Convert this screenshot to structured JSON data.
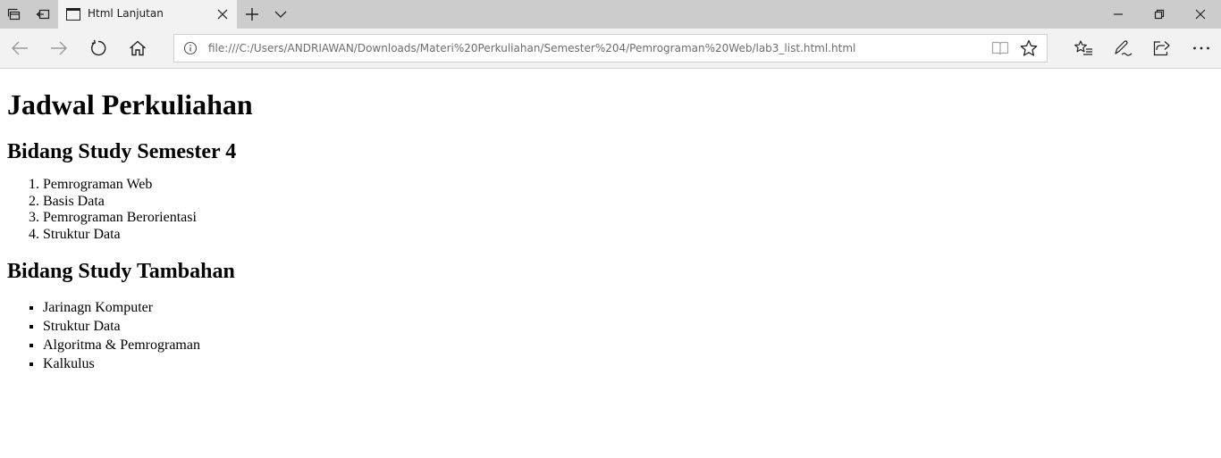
{
  "browser": {
    "tab": {
      "title": "Html Lanjutan"
    },
    "address": {
      "url": "file:///C:/Users/ANDRIAWAN/Downloads/Materi%20Perkuliahan/Semester%204/Pemrograman%20Web/lab3_list.html.html"
    },
    "icons": [
      "tab-manager-icon",
      "set-aside-tabs-icon",
      "page-icon",
      "close-icon",
      "plus-icon",
      "chevron-down-icon",
      "minimize-icon",
      "restore-icon",
      "window-close-icon",
      "back-arrow-icon",
      "forward-arrow-icon",
      "refresh-icon",
      "home-icon",
      "info-icon",
      "reading-view-icon",
      "star-icon",
      "favorites-icon",
      "pen-icon",
      "share-icon",
      "more-icon"
    ]
  },
  "page": {
    "title": "Jadwal Perkuliahan",
    "section1": {
      "heading": "Bidang Study Semester 4",
      "items": [
        "Pemrograman Web",
        "Basis Data",
        "Pemrograman Berorientasi",
        "Struktur Data"
      ]
    },
    "section2": {
      "heading": "Bidang Study Tambahan",
      "items": [
        "Jarinagn Komputer",
        "Struktur Data",
        "Algoritma & Pemrograman",
        "Kalkulus"
      ]
    }
  }
}
